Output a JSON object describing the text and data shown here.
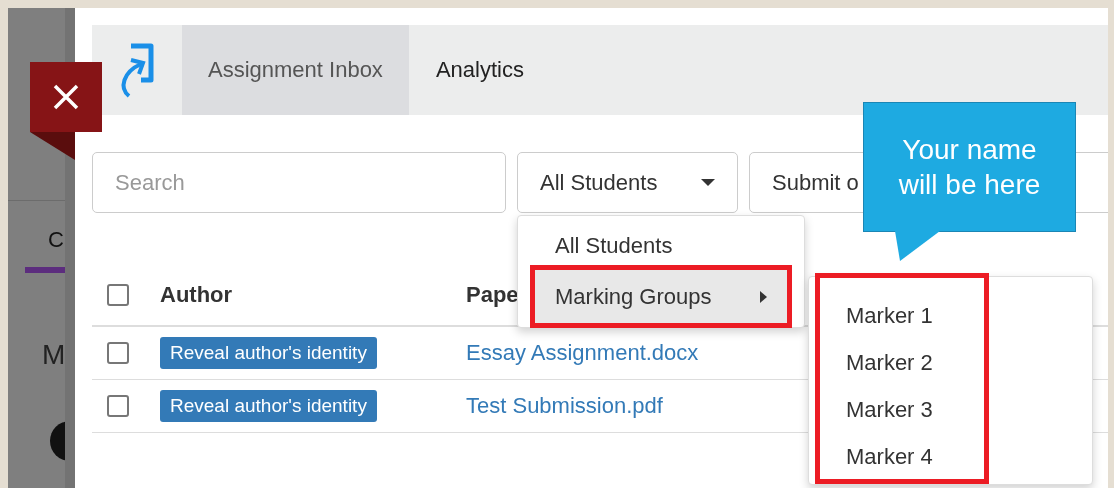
{
  "background_page": {
    "labels": [
      "C",
      "M"
    ]
  },
  "tabs": [
    {
      "label": "Assignment Inbox",
      "selected": true
    },
    {
      "label": "Analytics",
      "selected": false
    }
  ],
  "filters": {
    "search": {
      "placeholder": "Search"
    },
    "student_filter": {
      "value": "All Students"
    },
    "submission_filter": {
      "value": "Submit o"
    }
  },
  "table": {
    "select_all": {
      "checked": false
    },
    "columns": [
      "Author",
      "Pape"
    ],
    "rows": [
      {
        "checked": false,
        "author_button": "Reveal author's identity",
        "paper": "Essay Assignment.docx"
      },
      {
        "checked": false,
        "author_button": "Reveal author's identity",
        "paper": "Test Submission.pdf"
      }
    ]
  },
  "dropdown": {
    "items": [
      {
        "label": "All Students",
        "selected": false,
        "submenu": false
      },
      {
        "label": "Marking Groups",
        "selected": true,
        "submenu": true
      }
    ]
  },
  "submenu": {
    "items": [
      "Marker 1",
      "Marker 2",
      "Marker 3",
      "Marker 4"
    ]
  },
  "callout": {
    "lines": [
      "Your name",
      "will be here"
    ]
  }
}
